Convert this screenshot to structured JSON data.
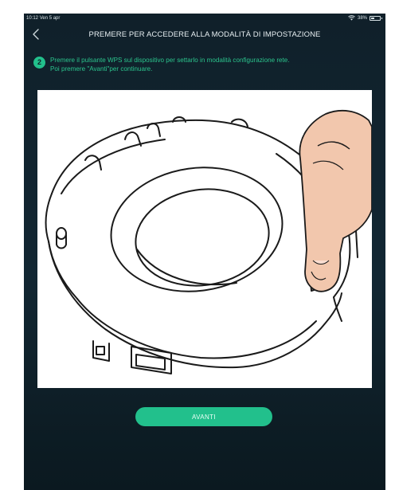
{
  "status_bar": {
    "time": "10:12",
    "date": "Ven 5 apr",
    "battery_percent": "38%",
    "battery_level": 0.38
  },
  "nav": {
    "title": "PREMERE PER ACCEDERE ALLA MODALITÀ DI IMPOSTAZIONE",
    "back_icon": "chevron-left-icon"
  },
  "instruction": {
    "step": "2",
    "line1": "Premere il pulsante WPS sul dispositivo per settarlo in modalità configurazione rete.",
    "line2": "Poi premere \"Avanti\"per continuare."
  },
  "illustration": {
    "subject": "device-wps-button-press"
  },
  "actions": {
    "next_label": "AVANTI"
  },
  "colors": {
    "accent": "#22c08c",
    "background": "#122733",
    "title_text": "#e6eef1"
  }
}
